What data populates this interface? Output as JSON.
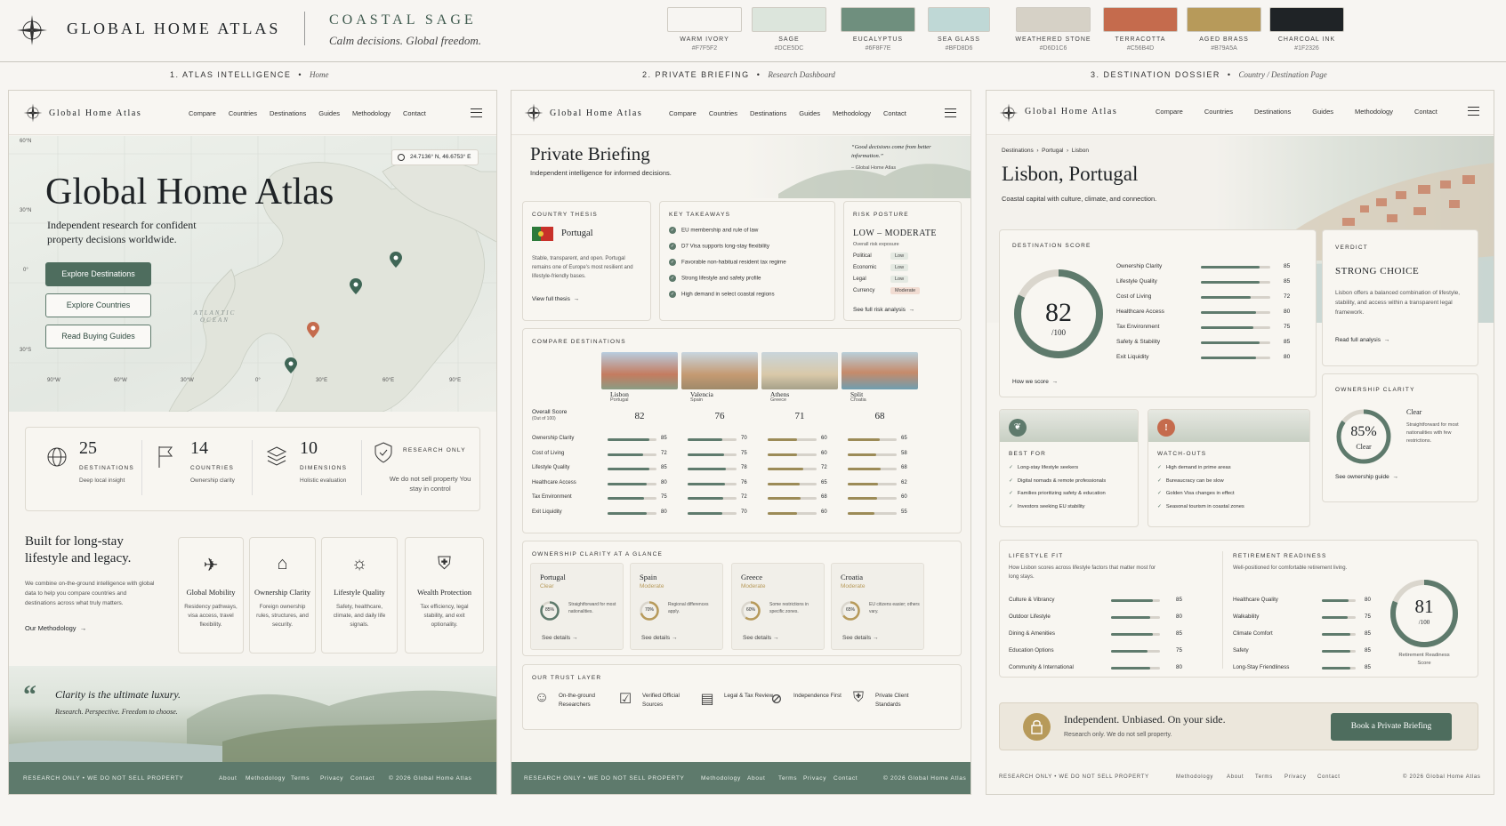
{
  "header": {
    "brand": "GLOBAL HOME ATLAS",
    "theme_title": "COASTAL SAGE",
    "theme_tagline": "Calm decisions. Global freedom."
  },
  "palette": [
    {
      "name": "WARM IVORY",
      "hex": "#F7F5F2"
    },
    {
      "name": "SAGE",
      "hex": "#DCE5DC"
    },
    {
      "name": "EUCALYPTUS",
      "hex": "#6F8F7E"
    },
    {
      "name": "SEA GLASS",
      "hex": "#BFD8D6"
    },
    {
      "name": "WEATHERED STONE",
      "hex": "#D6D1C6"
    },
    {
      "name": "TERRACOTTA",
      "hex": "#C56B4D"
    },
    {
      "name": "AGED BRASS",
      "hex": "#B79A5A"
    },
    {
      "name": "CHARCOAL INK",
      "hex": "#1F2326"
    }
  ],
  "sections": [
    {
      "label": "1. ATLAS INTELLIGENCE",
      "sub": "Home"
    },
    {
      "label": "2. PRIVATE BRIEFING",
      "sub": "Research Dashboard"
    },
    {
      "label": "3. DESTINATION DOSSIER",
      "sub": "Country / Destination Page"
    }
  ],
  "nav": {
    "brand": "Global Home Atlas",
    "links": [
      "Compare",
      "Countries",
      "Destinations",
      "Guides",
      "Methodology",
      "Contact"
    ]
  },
  "home": {
    "coords": "24.7136° N, 46.6753° E",
    "title": "Global Home Atlas",
    "subtitle": "Independent research for confident property decisions worldwide.",
    "buttons": [
      "Explore Destinations",
      "Explore Countries",
      "Read Buying Guides"
    ],
    "lat_labels": [
      "60°N",
      "30°N",
      "0°",
      "30°S"
    ],
    "lon_labels": [
      "90°W",
      "60°W",
      "30°W",
      "0°",
      "30°E",
      "60°E",
      "90°E"
    ],
    "ocean": "ATLANTIC OCEAN",
    "stats": [
      {
        "num": "25",
        "label": "DESTINATIONS",
        "sub": "Deep local insight"
      },
      {
        "num": "14",
        "label": "COUNTRIES",
        "sub": "Ownership clarity"
      },
      {
        "num": "10",
        "label": "DIMENSIONS",
        "sub": "Holistic evaluation"
      },
      {
        "num": "",
        "label": "RESEARCH ONLY",
        "sub": "We do not sell property You stay in control"
      }
    ],
    "long_title": "Built for long-stay lifestyle and legacy.",
    "long_text": "We combine on-the-ground intelligence with global data to help you compare countries and destinations across what truly matters.",
    "methodology_link": "Our Methodology",
    "features": [
      {
        "title": "Global Mobility",
        "text": "Residency pathways, visa access, travel flexibility."
      },
      {
        "title": "Ownership Clarity",
        "text": "Foreign ownership rules, structures, and security."
      },
      {
        "title": "Lifestyle Quality",
        "text": "Safety, healthcare, climate, and daily life signals."
      },
      {
        "title": "Wealth Protection",
        "text": "Tax efficiency, legal stability, and exit optionality."
      }
    ],
    "quote": "Clarity is the ultimate luxury.",
    "quote_sub": "Research. Perspective. Freedom to choose.",
    "footer_left": "RESEARCH ONLY  •  WE DO NOT SELL PROPERTY",
    "footer_links": [
      "About",
      "Methodology",
      "Terms",
      "Privacy",
      "Contact"
    ],
    "footer_copy": "© 2026 Global Home Atlas"
  },
  "briefing": {
    "title": "Private Briefing",
    "subtitle": "Independent intelligence for informed decisions.",
    "quote": "“Good decisions come from better information.”",
    "quote_by": "– Global Home Atlas",
    "thesis_label": "COUNTRY THESIS",
    "thesis_country": "Portugal",
    "thesis_text": "Stable, transparent, and open. Portugal remains one of Europe's most resilient and lifestyle-friendly bases.",
    "thesis_link": "View full thesis",
    "takeaways_label": "KEY TAKEAWAYS",
    "takeaways": [
      "EU membership and rule of law",
      "D7 Visa supports long-stay flexibility",
      "Favorable non-habitual resident tax regime",
      "Strong lifestyle and safety profile",
      "High demand in select coastal regions"
    ],
    "risk_label": "RISK POSTURE",
    "risk_value": "LOW – MODERATE",
    "risk_sub": "Overall risk exposure",
    "risks": [
      {
        "k": "Political",
        "v": "Low"
      },
      {
        "k": "Economic",
        "v": "Low"
      },
      {
        "k": "Legal",
        "v": "Low"
      },
      {
        "k": "Currency",
        "v": "Moderate"
      }
    ],
    "risk_link": "See full risk analysis",
    "compare_label": "COMPARE DESTINATIONS",
    "overall_label": "Overall Score",
    "overall_sub": "(Out of 100)",
    "destinations": [
      {
        "name": "Lisbon",
        "country": "Portugal",
        "score": "82",
        "vals": [
          85,
          72,
          85,
          80,
          75,
          80
        ]
      },
      {
        "name": "Valencia",
        "country": "Spain",
        "score": "76",
        "vals": [
          70,
          75,
          78,
          76,
          72,
          70
        ]
      },
      {
        "name": "Athens",
        "country": "Greece",
        "score": "71",
        "vals": [
          60,
          60,
          72,
          65,
          68,
          60
        ]
      },
      {
        "name": "Split",
        "country": "Croatia",
        "score": "68",
        "vals": [
          65,
          58,
          68,
          62,
          60,
          55
        ]
      }
    ],
    "metrics": [
      "Ownership Clarity",
      "Cost of Living",
      "Lifestyle Quality",
      "Healthcare Access",
      "Tax Environment",
      "Exit Liquidity"
    ],
    "clarity_label": "OWNERSHIP CLARITY AT A GLANCE",
    "clarity": [
      {
        "country": "Portugal",
        "status": "Clear",
        "pct": "85%",
        "p": 85,
        "note": "Straightforward for most nationalities."
      },
      {
        "country": "Spain",
        "status": "Moderate",
        "pct": "70%",
        "p": 70,
        "note": "Regional differences apply."
      },
      {
        "country": "Greece",
        "status": "Moderate",
        "pct": "60%",
        "p": 60,
        "note": "Some restrictions in specific zones."
      },
      {
        "country": "Croatia",
        "status": "Moderate",
        "pct": "65%",
        "p": 65,
        "note": "EU citizens easier; others vary."
      }
    ],
    "see_details": "See details",
    "trust_label": "OUR TRUST LAYER",
    "trust": [
      "On-the-ground Researchers",
      "Verified Official Sources",
      "Legal & Tax Review",
      "Independence First",
      "Private Client Standards"
    ],
    "footer_left": "RESEARCH ONLY  •  WE DO NOT SELL PROPERTY",
    "footer_links": [
      "Methodology",
      "About",
      "Terms",
      "Privacy",
      "Contact"
    ],
    "footer_copy": "© 2026 Global Home Atlas"
  },
  "dossier": {
    "breadcrumb": [
      "Destinations",
      "Portugal",
      "Lisbon"
    ],
    "title": "Lisbon, Portugal",
    "subtitle": "Coastal capital with culture, climate, and connection.",
    "score_label": "DESTINATION SCORE",
    "score": "82",
    "score_of": "/100",
    "score_p": 82,
    "how_link": "How we score",
    "score_items": [
      {
        "k": "Ownership Clarity",
        "v": 85
      },
      {
        "k": "Lifestyle Quality",
        "v": 85
      },
      {
        "k": "Cost of Living",
        "v": 72
      },
      {
        "k": "Healthcare Access",
        "v": 80
      },
      {
        "k": "Tax Environment",
        "v": 75
      },
      {
        "k": "Safety & Stability",
        "v": 85
      },
      {
        "k": "Exit Liquidity",
        "v": 80
      }
    ],
    "verdict_label": "VERDICT",
    "verdict": "STRONG CHOICE",
    "verdict_text": "Lisbon offers a balanced combination of lifestyle, stability, and access within a transparent legal framework.",
    "verdict_link": "Read full analysis",
    "oc_label": "OWNERSHIP CLARITY",
    "oc_pct": "85%",
    "oc_p": 85,
    "oc_status": "Clear",
    "oc_title": "Clear",
    "oc_text": "Straightforward for most nationalities with few restrictions.",
    "oc_link": "See ownership guide",
    "bestfor_label": "BEST FOR",
    "bestfor": [
      "Long-stay lifestyle seekers",
      "Digital nomads & remote professionals",
      "Families prioritizing safety & education",
      "Investors seeking EU stability"
    ],
    "watch_label": "WATCH-OUTS",
    "watch": [
      "High demand in prime areas",
      "Bureaucracy can be slow",
      "Golden Visa changes in effect",
      "Seasonal tourism in coastal zones"
    ],
    "lifestyle_label": "LIFESTYLE FIT",
    "lifestyle_sub": "How Lisbon scores across lifestyle factors that matter most for long stays.",
    "lifestyle": [
      {
        "k": "Culture & Vibrancy",
        "v": 85
      },
      {
        "k": "Outdoor Lifestyle",
        "v": 80
      },
      {
        "k": "Dining & Amenities",
        "v": 85
      },
      {
        "k": "Education Options",
        "v": 75
      },
      {
        "k": "Community & International",
        "v": 80
      }
    ],
    "retire_label": "RETIREMENT READINESS",
    "retire_sub": "Well-positioned for comfortable retirement living.",
    "retire": [
      {
        "k": "Healthcare Quality",
        "v": 80
      },
      {
        "k": "Walkability",
        "v": 75
      },
      {
        "k": "Climate Comfort",
        "v": 85
      },
      {
        "k": "Safety",
        "v": 85
      },
      {
        "k": "Long-Stay Friendliness",
        "v": 85
      }
    ],
    "retire_score": "81",
    "retire_of": "/100",
    "retire_p": 81,
    "retire_caption": "Retirement Readiness Score",
    "cta_title": "Independent. Unbiased. On your side.",
    "cta_sub": "Research only. We do not sell property.",
    "cta_button": "Book a Private Briefing",
    "footer_left": "RESEARCH ONLY  •  WE DO NOT SELL PROPERTY",
    "footer_links": [
      "Methodology",
      "About",
      "Terms",
      "Privacy",
      "Contact"
    ],
    "footer_copy": "© 2026 Global Home Atlas"
  }
}
